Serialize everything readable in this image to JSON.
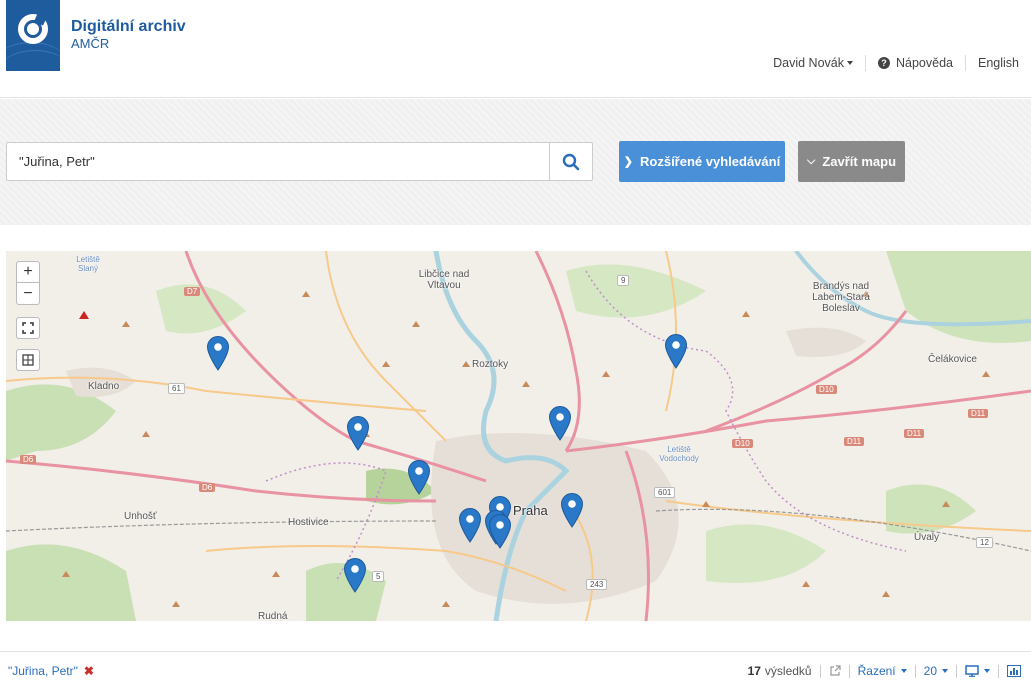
{
  "header": {
    "title": "Digitální archiv",
    "subtitle": "AMČR",
    "user": "David Novák",
    "help": "Nápověda",
    "language": "English"
  },
  "search": {
    "value": "\"Juřina, Petr\"",
    "advanced_label": "Rozšířené vyhledávání",
    "close_map_label": "Zavřít mapu"
  },
  "map": {
    "zoom_in": "+",
    "zoom_out": "−",
    "places": [
      {
        "name": "Letiště Slaný"
      },
      {
        "name": "Libčice nad Vltavou"
      },
      {
        "name": "Brandýs nad Labem-Stará Boleslav"
      },
      {
        "name": "Kladno"
      },
      {
        "name": "Roztoky"
      },
      {
        "name": "Čelákovice"
      },
      {
        "name": "Letiště Vodochody"
      },
      {
        "name": "Praha"
      },
      {
        "name": "Unhošť"
      },
      {
        "name": "Hostivice"
      },
      {
        "name": "Úvaly"
      },
      {
        "name": "Rudná"
      }
    ],
    "roads": [
      "D7",
      "61",
      "9",
      "D6",
      "D6",
      "D10",
      "D10",
      "D11",
      "D11",
      "D11",
      "601",
      "12",
      "243",
      "5"
    ],
    "marker_count": 11,
    "marker_color": "#2a78c8"
  },
  "footer": {
    "filter_label": "\"Juřina, Petr\"",
    "results_count": "17",
    "results_label": "výsledků",
    "sort_label": "Řazení",
    "per_page": "20"
  },
  "colors": {
    "brand": "#1f5c9e",
    "primary_button": "#4a90d9",
    "secondary_button": "#8a8a8a",
    "link": "#2a6ebb",
    "remove": "#c9302c"
  }
}
